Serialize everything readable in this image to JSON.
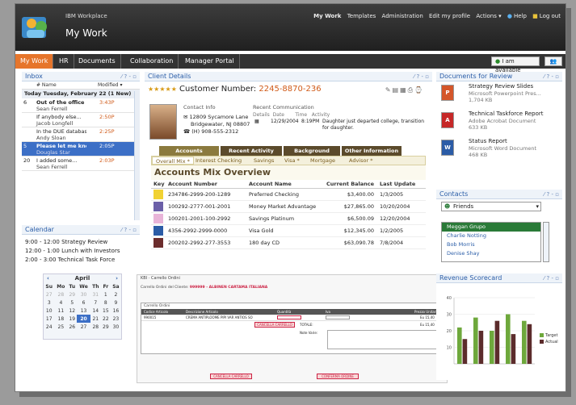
{
  "header": {
    "brand": "IBM Workplace",
    "app_title": "My Work",
    "links": [
      "My Work",
      "Templates",
      "Administration",
      "Edit my profile",
      "Actions ▾",
      "Help",
      "Log out"
    ]
  },
  "nav": {
    "tabs": [
      "My Work",
      "HR",
      "Documents",
      "Collaboration",
      "Manager Portal"
    ],
    "availability": "I am available"
  },
  "inbox": {
    "title": "Inbox",
    "controls": "⁄ ? ‐ ▫",
    "col_name": "# Name",
    "col_modified": "Modified ▾",
    "today": "Today Tuesday, February 22 (1 New)",
    "messages": [
      {
        "count": "6",
        "subject": "Out of the office",
        "from": "Sean Ferrell",
        "time": "3:43P"
      },
      {
        "count": "",
        "subject": "If anybody else...",
        "from": "Jacob Longfell",
        "time": "2:50P"
      },
      {
        "count": "",
        "subject": "In the DUE database",
        "from": "Andy Sloan",
        "time": "2:25P"
      },
      {
        "count": "5",
        "subject": "Please let me kno",
        "from": "Douglas Star",
        "time": "2:05P"
      },
      {
        "count": "20",
        "subject": "I added some...",
        "from": "Sean Ferrell",
        "time": "2:03P"
      }
    ]
  },
  "calendar": {
    "title": "Calendar",
    "events": [
      "9:00 - 12:00  Strategy Review",
      "12:00 - 1:00  Lunch with Investors",
      "2:00 - 3:00   Technical Task Force"
    ],
    "month": "April",
    "weekdays": [
      "Su",
      "Mo",
      "Tu",
      "We",
      "Th",
      "Fr",
      "Sa"
    ],
    "weeks": [
      [
        "27",
        "28",
        "29",
        "30",
        "31",
        "1",
        "2"
      ],
      [
        "3",
        "4",
        "5",
        "6",
        "7",
        "8",
        "9"
      ],
      [
        "10",
        "11",
        "12",
        "13",
        "14",
        "15",
        "16"
      ],
      [
        "17",
        "18",
        "19",
        "20",
        "21",
        "22",
        "23"
      ],
      [
        "24",
        "25",
        "26",
        "27",
        "28",
        "29",
        "30"
      ]
    ],
    "today": "20"
  },
  "client": {
    "title": "Client Details",
    "stars": "★★★★★",
    "customer_label": "Customer Number:",
    "customer_number": "2245-8870-236",
    "contact_info": "Contact Info",
    "address_1": "12809 Sycamore Lane",
    "address_2": "Bridgewater, NJ 08807",
    "phone": "(H) 908-555-2312",
    "recent_comm": "Recent Communication",
    "comm_details": "Details",
    "comm_date_h": "Date",
    "comm_time_h": "Time",
    "comm_activity_h": "Activity",
    "comm_date": "12/29/2004",
    "comm_time": "8:19PM",
    "comm_activity": "Daughter just departed college, transition for daughter.",
    "tabs": [
      "Accounts",
      "Recent Activity",
      "Background",
      "Other Information"
    ],
    "subtabs": [
      "Overall Mix *",
      "Interest Checking",
      "Savings",
      "Visa *",
      "Mortgage",
      "Advisor *"
    ],
    "mix_title": "Accounts Mix Overview",
    "columns": [
      "Key",
      "Account Number",
      "Account Name",
      "Current Balance",
      "Last Update"
    ],
    "accounts": [
      {
        "color": "#f1d233",
        "number": "234786-2999-200-1289",
        "name": "Preferred Checking",
        "balance": "$3,400.00",
        "updated": "1/3/2005"
      },
      {
        "color": "#6b5fa8",
        "number": "100292-2777-001-2001",
        "name": "Money Market Advantage",
        "balance": "$27,865.00",
        "updated": "10/20/2004"
      },
      {
        "color": "#e8b4d8",
        "number": "100201-2001-100-2992",
        "name": "Savings Platinum",
        "balance": "$6,500.09",
        "updated": "12/20/2004"
      },
      {
        "color": "#2b5ca6",
        "number": "4356-2992-2999-0000",
        "name": "Visa Gold",
        "balance": "$12,345.00",
        "updated": "1/2/2005"
      },
      {
        "color": "#6b2c2c",
        "number": "200202-2992-277-3553",
        "name": "180 day CD",
        "balance": "$63,090.78",
        "updated": "7/8/2004"
      }
    ]
  },
  "bottom_form": {
    "tab": "KBI · Carrello Ordini",
    "label": "Carrello Ordini del Cliente:",
    "customer": "999999 - ALBINEN CARTAMA ITALIANA",
    "section": "Carrello Ordini",
    "columns": [
      "Codice Articolo",
      "Descrizione Articolo",
      "Quantità",
      "Iva",
      "Prezzo Unitario"
    ],
    "row": {
      "code": "990015",
      "desc": "CREMA ANTIPLOOME PIPI VAR ANTIOS SO",
      "price": "Eu 15,40"
    },
    "total_label": "TOTALE:",
    "total": "Eu 15,40",
    "note_label": "Note Varie:",
    "button_1": "CANCELLA CARRELLO",
    "button_2": "CONFERMA ORDINE"
  },
  "documents": {
    "title": "Documents for Review",
    "items": [
      {
        "title": "Strategy Review Slides",
        "type": "Microsoft Powerpoint Pres...",
        "size": "1,704 KB",
        "icon": "powerpoint-icon",
        "color": "#d4562a",
        "glyph": "P"
      },
      {
        "title": "Technical Taskforce Report",
        "type": "Adobe Acrobat Document",
        "size": "633 KB",
        "icon": "pdf-icon",
        "color": "#c62828",
        "glyph": "A"
      },
      {
        "title": "Status Report",
        "type": "Microsoft Word Document",
        "size": "468 KB",
        "icon": "word-icon",
        "color": "#2b5ca6",
        "glyph": "W"
      }
    ]
  },
  "contacts": {
    "title": "Contacts",
    "group": "Friends",
    "people": [
      "Meggan Grupo",
      "Charlie Notting",
      "Bob Morris",
      "Denise Shay"
    ]
  },
  "scorecard": {
    "title": "Revenue Scorecard",
    "legend": [
      "Target",
      "Actual"
    ]
  },
  "chart_data": {
    "type": "bar",
    "categories": [
      "Q1",
      "Q2",
      "Q3",
      "Q4",
      "Q5"
    ],
    "ylim": [
      0,
      40
    ],
    "ticks": [
      "40",
      "30",
      "20",
      "10"
    ],
    "series": [
      {
        "name": "Target",
        "values": [
          22,
          28,
          20,
          30,
          26
        ],
        "color": "#6ea83c"
      },
      {
        "name": "Actual",
        "values": [
          15,
          20,
          26,
          18,
          24
        ],
        "color": "#5c2c2c"
      }
    ]
  }
}
